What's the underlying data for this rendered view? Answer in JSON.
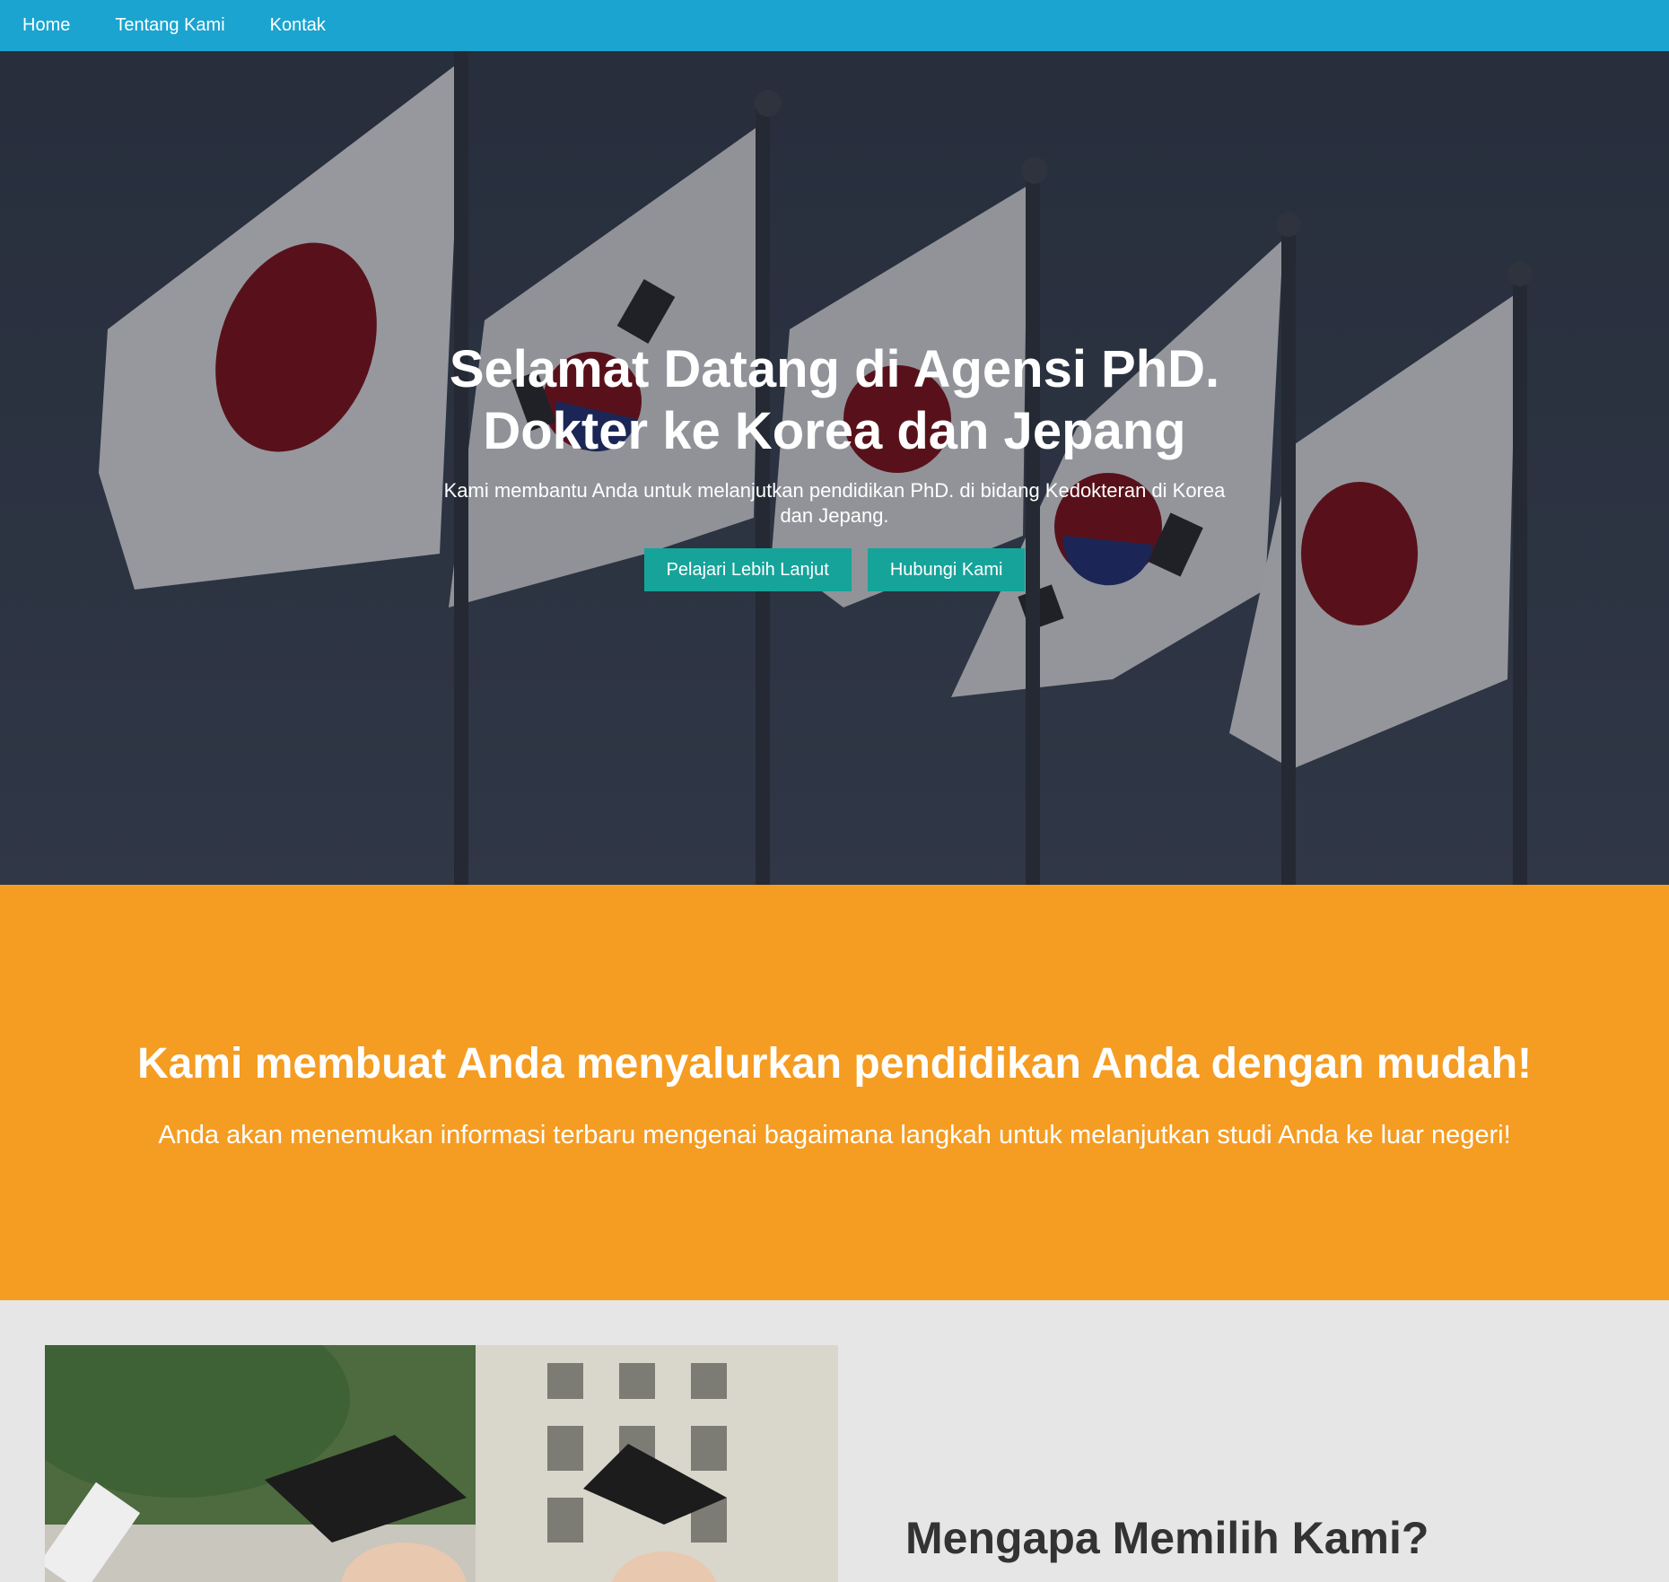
{
  "nav": {
    "items": [
      {
        "label": "Home"
      },
      {
        "label": "Tentang Kami"
      },
      {
        "label": "Kontak"
      }
    ]
  },
  "hero": {
    "title": "Selamat Datang di Agensi PhD. Dokter ke Korea dan Jepang",
    "subtitle": "Kami membantu Anda untuk melanjutkan pendidikan PhD. di bidang Kedokteran di Korea dan Jepang.",
    "primary_button": "Pelajari Lebih Lanjut",
    "secondary_button": "Hubungi Kami"
  },
  "promo": {
    "title": "Kami membuat Anda menyalurkan pendidikan Anda dengan mudah!",
    "text": "Anda akan menemukan informasi terbaru mengenai bagaimana langkah untuk melanjutkan studi Anda ke luar negeri!"
  },
  "why": {
    "title": "Mengapa Memilih Kami?"
  },
  "colors": {
    "nav": "#1ba4cf",
    "button": "#16a39a",
    "promo": "#f59c22",
    "section_bg": "#e6e6e6"
  }
}
